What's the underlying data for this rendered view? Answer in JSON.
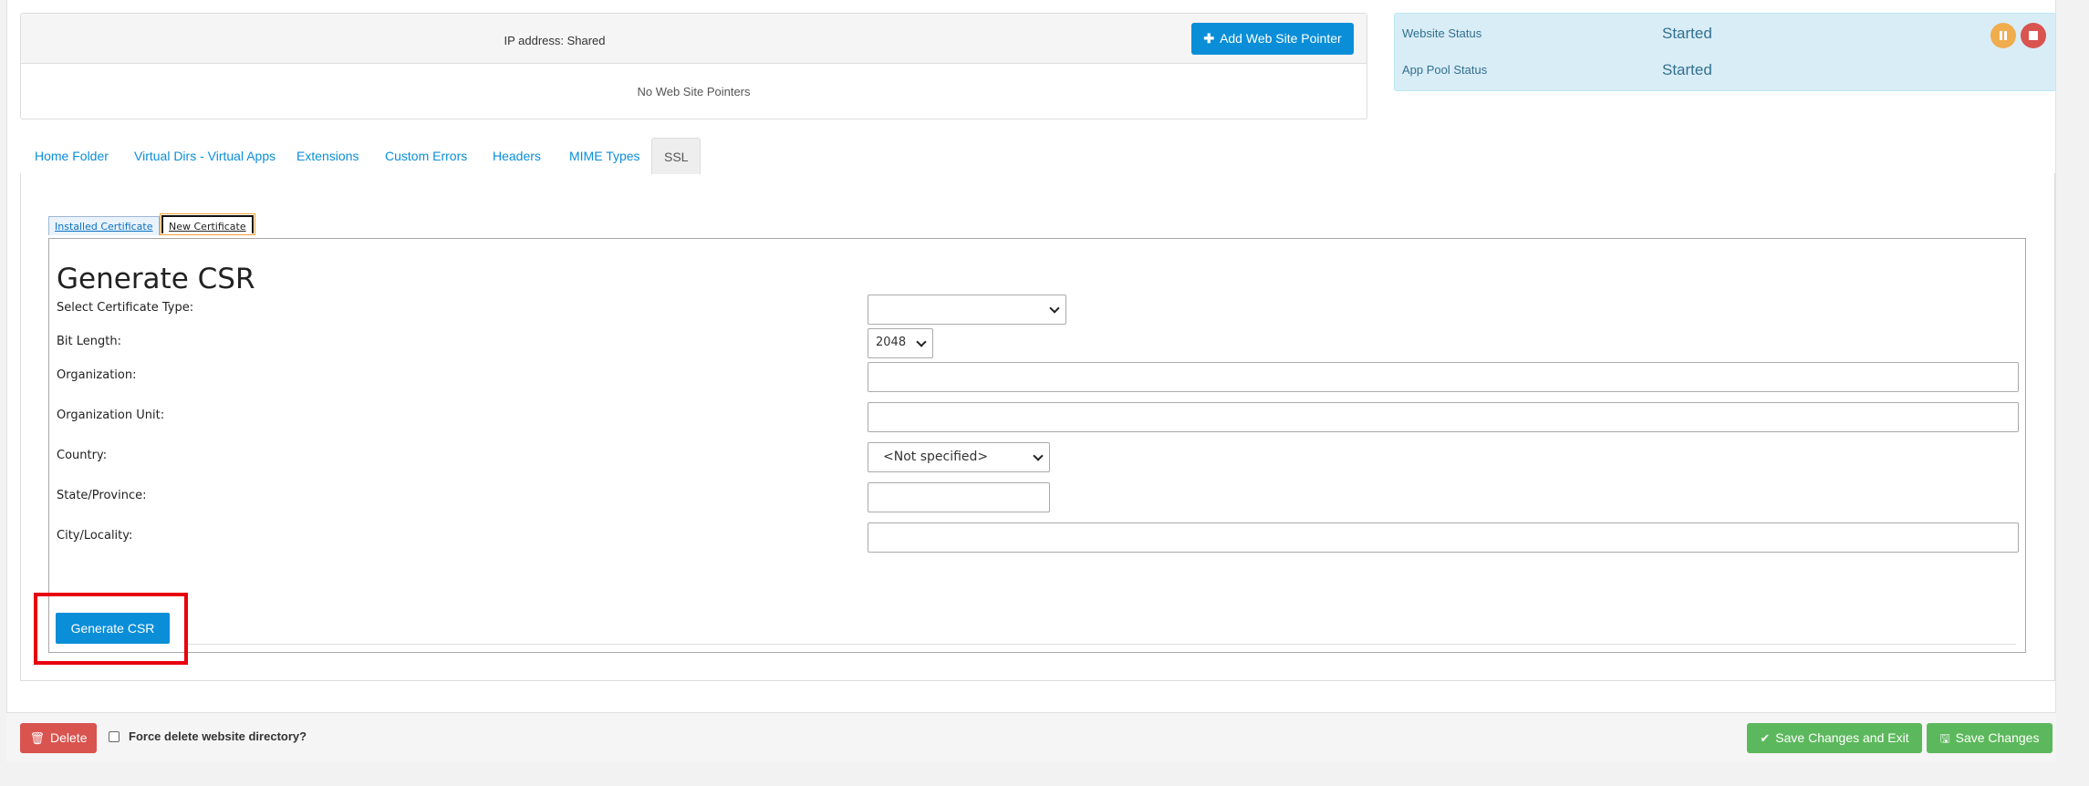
{
  "pointers": {
    "ip_text": "IP address: Shared",
    "add_button_label": "Add Web Site Pointer",
    "add_icon": "plus-icon",
    "empty_text": "No Web Site Pointers"
  },
  "status": {
    "website_label": "Website Status",
    "website_value": "Started",
    "apppool_label": "App Pool Status",
    "apppool_value": "Started",
    "pause_icon": "pause-icon",
    "stop_icon": "stop-icon",
    "pause_color": "#f0ad4e",
    "stop_color": "#d9534f"
  },
  "tabs": [
    {
      "label": "Home Folder"
    },
    {
      "label": "Virtual Dirs - Virtual Apps"
    },
    {
      "label": "Extensions"
    },
    {
      "label": "Custom Errors"
    },
    {
      "label": "Headers"
    },
    {
      "label": "MIME Types"
    },
    {
      "label": "SSL",
      "active": true
    }
  ],
  "inner_tabs": {
    "installed": "Installed Certificate",
    "new": "New Certificate",
    "active": "New Certificate"
  },
  "csr": {
    "title": "Generate CSR",
    "cert_type_label": "Select Certificate Type:",
    "cert_type_value": "",
    "bit_length_label": "Bit Length:",
    "bit_length_value": "2048",
    "org_label": "Organization:",
    "org_value": "",
    "org_unit_label": "Organization Unit:",
    "org_unit_value": "",
    "country_label": "Country:",
    "country_value": "<Not specified>",
    "state_label": "State/Province:",
    "state_value": "",
    "city_label": "City/Locality:",
    "city_value": "",
    "generate_button": "Generate CSR"
  },
  "footer": {
    "delete_label": "Delete",
    "delete_icon": "trash-icon",
    "force_label": "Force delete website directory?",
    "force_checked": false,
    "save_exit_label": "Save Changes and Exit",
    "save_exit_icon": "check-icon",
    "save_label": "Save Changes",
    "save_icon": "save-icon"
  },
  "colors": {
    "accent": "#0a8ed8",
    "success": "#5cb85c",
    "danger": "#d9534f",
    "highlight": "#e8000b"
  }
}
